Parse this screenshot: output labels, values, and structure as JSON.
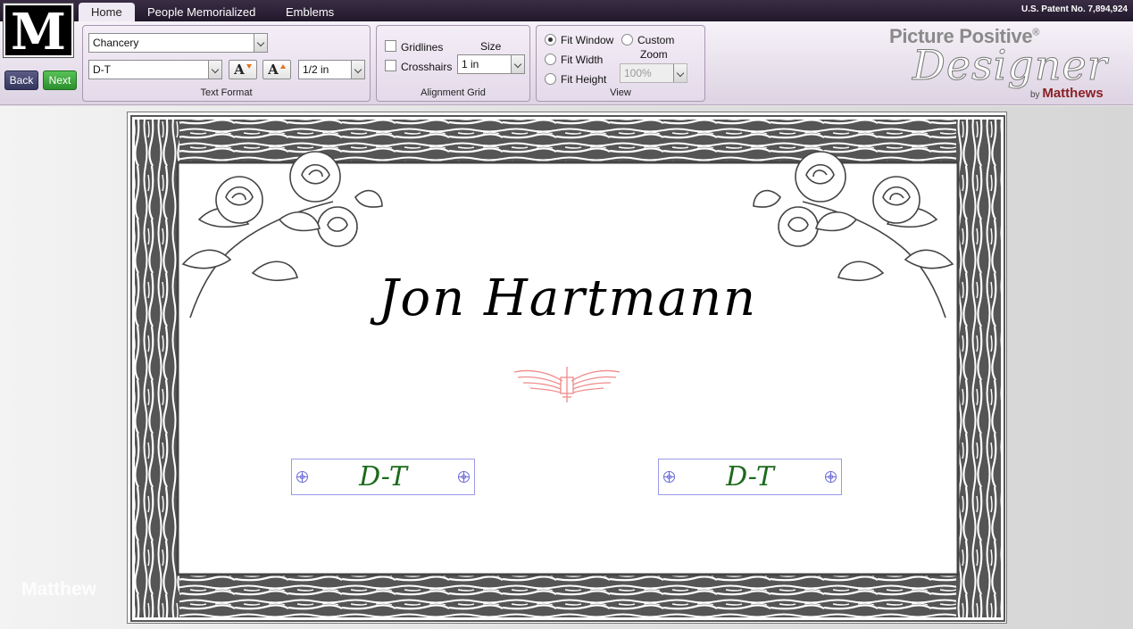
{
  "tabs": [
    {
      "label": "Home",
      "active": true
    },
    {
      "label": "People Memorialized",
      "active": false
    },
    {
      "label": "Emblems",
      "active": false
    }
  ],
  "patent": "U.S. Patent No. 7,894,924",
  "logo": {
    "letter": "M"
  },
  "nav": {
    "back_label": "Back",
    "next_label": "Next"
  },
  "text_format": {
    "group_label": "Text Format",
    "font_value": "Chancery",
    "text_value": "D-T",
    "size_value": "1/2 in",
    "decrease_label": "A",
    "increase_label": "A"
  },
  "alignment_grid": {
    "group_label": "Alignment Grid",
    "gridlines_label": "Gridlines",
    "crosshairs_label": "Crosshairs",
    "size_label": "Size",
    "size_value": "1 in"
  },
  "view": {
    "group_label": "View",
    "fit_window_label": "Fit Window",
    "fit_width_label": "Fit Width",
    "fit_height_label": "Fit Height",
    "custom_label": "Custom",
    "zoom_label": "Zoom",
    "zoom_value": "100%",
    "selected": "Fit Window"
  },
  "brand": {
    "line1": "Picture Positive",
    "registered": "®",
    "line2": "Designer",
    "by": "by",
    "company": "Matthews"
  },
  "watermark": "Matthew",
  "design": {
    "name": "Jon Hartmann",
    "left_dates": "D-T",
    "right_dates": "D-T"
  },
  "colors": {
    "accent_purple": "#3a2d45",
    "next_green": "#2c8f2c",
    "date_text": "#1b6a1b",
    "emblem": "#f08a8a",
    "selection_border": "#9a9ae6"
  }
}
